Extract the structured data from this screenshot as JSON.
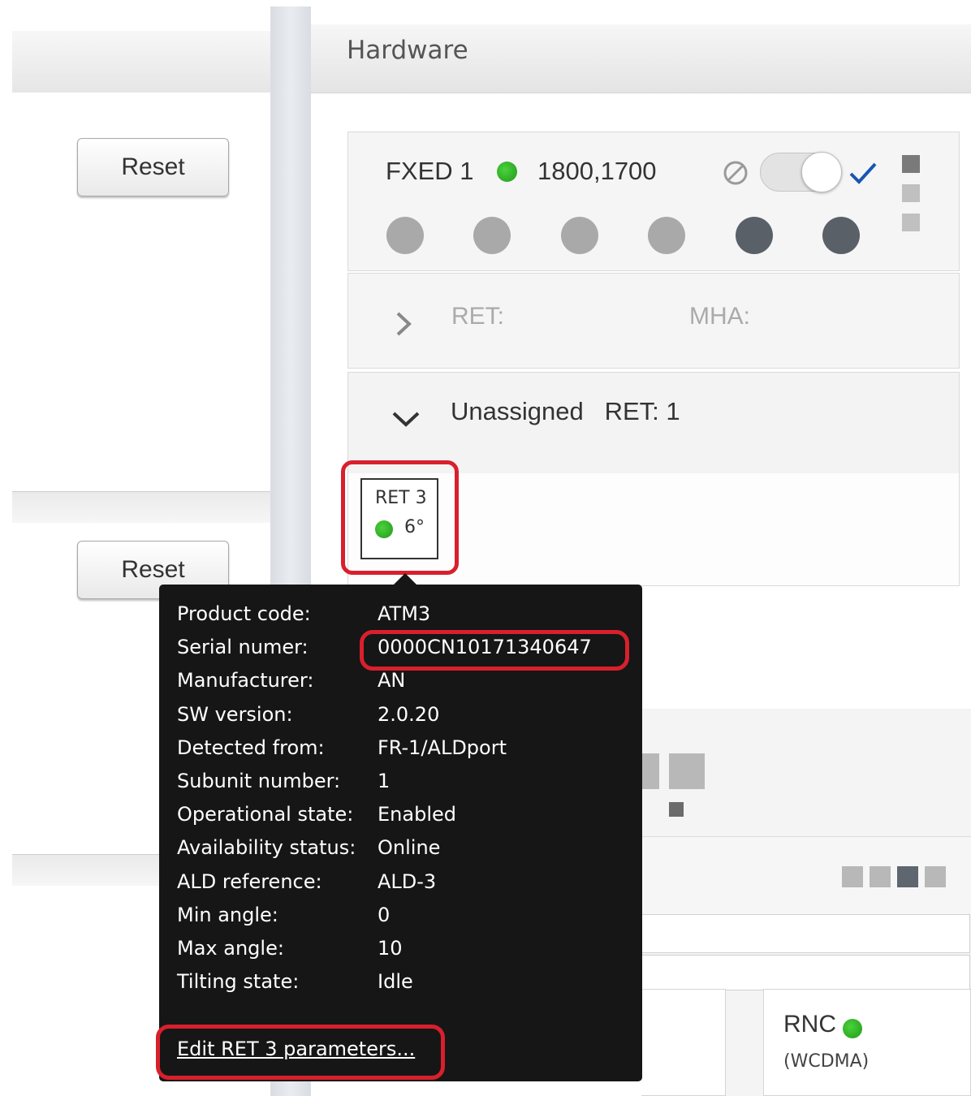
{
  "left_panel": {
    "reset_top_label": "Reset",
    "reset_bottom_label": "Reset"
  },
  "hardware": {
    "title": "Hardware",
    "fxed": {
      "name": "FXED 1",
      "frequencies": "1800,1700",
      "status_color": "#2aa41f",
      "toggle_on": true,
      "ports": [
        "light",
        "light",
        "light",
        "light",
        "dark",
        "dark"
      ]
    },
    "ret_row": {
      "ret_label": "RET:",
      "mha_label": "MHA:"
    },
    "unassigned": {
      "label": "Unassigned",
      "ret_count": "RET: 1"
    },
    "ret_tile": {
      "name": "RET 3",
      "angle": "6°"
    }
  },
  "tooltip": {
    "rows": [
      {
        "label": "Product code:",
        "value": "ATM3"
      },
      {
        "label": "Serial numer:",
        "value": "0000CN10171340647"
      },
      {
        "label": "Manufacturer:",
        "value": "AN"
      },
      {
        "label": "SW version:",
        "value": "2.0.20"
      },
      {
        "label": "Detected from:",
        "value": "FR-1/ALDport"
      },
      {
        "label": "Subunit number:",
        "value": "1"
      },
      {
        "label": "Operational state:",
        "value": "Enabled"
      },
      {
        "label": "Availability status:",
        "value": "Online"
      },
      {
        "label": "ALD reference:",
        "value": "ALD-3"
      },
      {
        "label": "Min angle:",
        "value": "0"
      },
      {
        "label": "Max angle:",
        "value": "10"
      },
      {
        "label": "Tilting state:",
        "value": "Idle"
      }
    ],
    "edit_link": "Edit RET 3 parameters..."
  },
  "rnc_card": {
    "title": "RNC",
    "subtitle": "(WCDMA)"
  },
  "colors": {
    "highlight": "#d8202c",
    "status_green": "#2aa41f",
    "accent_blue": "#1a56b0"
  }
}
